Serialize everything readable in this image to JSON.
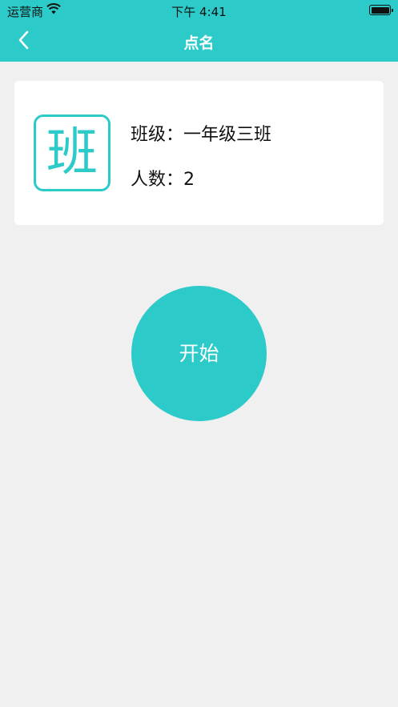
{
  "status_bar": {
    "carrier": "运营商",
    "time": "下午 4:41",
    "wifi_icon": "wifi-icon",
    "battery_icon": "battery-icon"
  },
  "nav": {
    "title": "点名",
    "back_icon": "chevron-left-icon"
  },
  "class_card": {
    "icon_char": "班",
    "class_label": "班级：",
    "class_value": "一年级三班",
    "count_label": "人数：",
    "count_value": "2"
  },
  "start_button": {
    "label": "开始"
  },
  "colors": {
    "accent": "#2ccac8",
    "background": "#f0f0f0",
    "card": "#ffffff"
  }
}
